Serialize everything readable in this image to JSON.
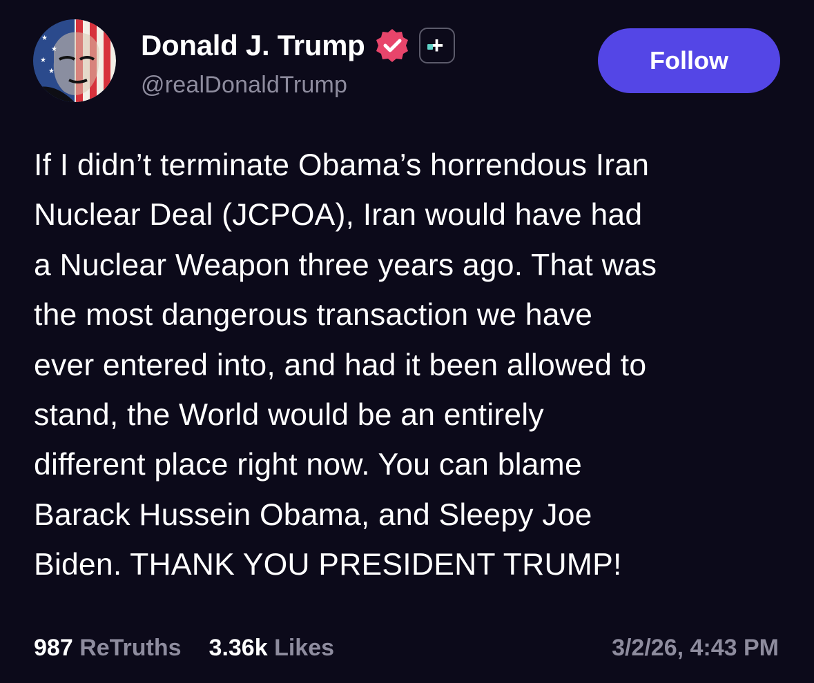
{
  "author": {
    "display_name": "Donald J. Trump",
    "handle": "@realDonaldTrump",
    "verified": true,
    "verified_color": "#e8456b",
    "plus_badge": "+"
  },
  "follow_button": {
    "label": "Follow",
    "color": "#5446e6"
  },
  "post": {
    "lines": [
      "If I didn’t terminate Obama’s horrendous Iran",
      "Nuclear Deal (JCPOA), Iran would have had",
      "a Nuclear Weapon three years ago. That was",
      "the most dangerous transaction we have",
      "ever entered into, and had it been allowed to",
      "stand, the World would be an entirely",
      "different place right now. You can blame",
      "Barack Hussein Obama, and Sleepy Joe",
      "Biden. THANK YOU PRESIDENT TRUMP!"
    ]
  },
  "stats": {
    "retruths_count": "987",
    "retruths_label": "ReTruths",
    "likes_count": "3.36k",
    "likes_label": "Likes"
  },
  "timestamp": "3/2/26, 4:43 PM",
  "colors": {
    "background": "#0c0a1a",
    "text": "#ffffff",
    "muted": "#8e8c9e"
  },
  "icons": {
    "verified": "verified-badge-icon",
    "plus": "plus-badge-icon"
  }
}
